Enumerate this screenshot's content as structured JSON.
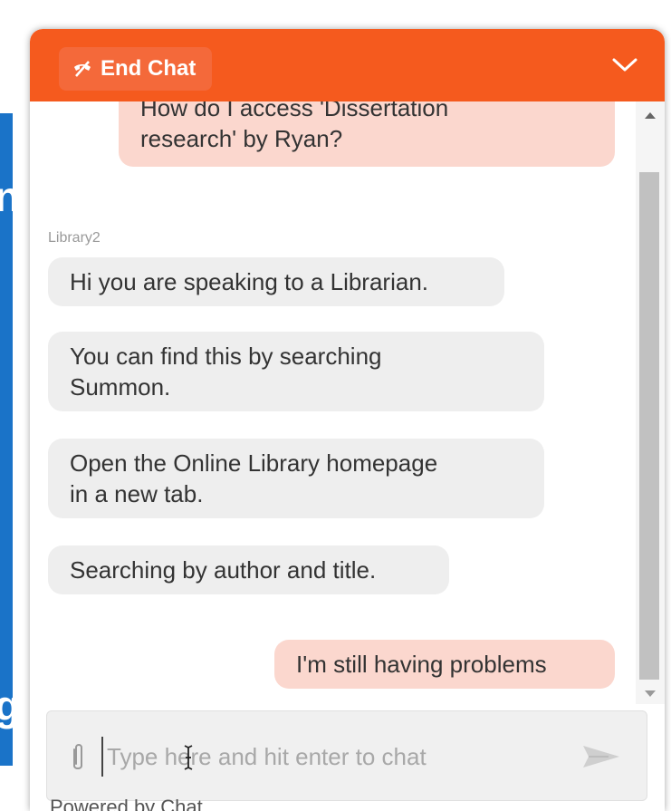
{
  "header": {
    "end_chat_label": "End Chat",
    "end_chat_icon": "end-chat-icon",
    "collapse_icon": "chevron-down-icon",
    "accent_color": "#f55a1e"
  },
  "messages": {
    "patron_partial": "How do I access 'Dissertation",
    "patron_line2": "research' by Ryan?",
    "sender_name": "Library2",
    "librarian_1": "Hi you are speaking to a Librarian.",
    "librarian_2_line1": "You can find this by searching",
    "librarian_2_line2": "Summon.",
    "librarian_3_line1": "Open the Online Library homepage",
    "librarian_3_line2": "in a new tab.",
    "librarian_4": "Searching by author and title.",
    "patron_2": "I'm still having problems"
  },
  "composer": {
    "placeholder": "Type here and hit enter to chat",
    "value": "",
    "attach_icon": "paperclip-icon",
    "send_icon": "send-icon"
  },
  "footer": {
    "powered_by": "Powered by Chat"
  },
  "background": {
    "side_letter_top": "n",
    "side_letter_bottom": "g"
  }
}
